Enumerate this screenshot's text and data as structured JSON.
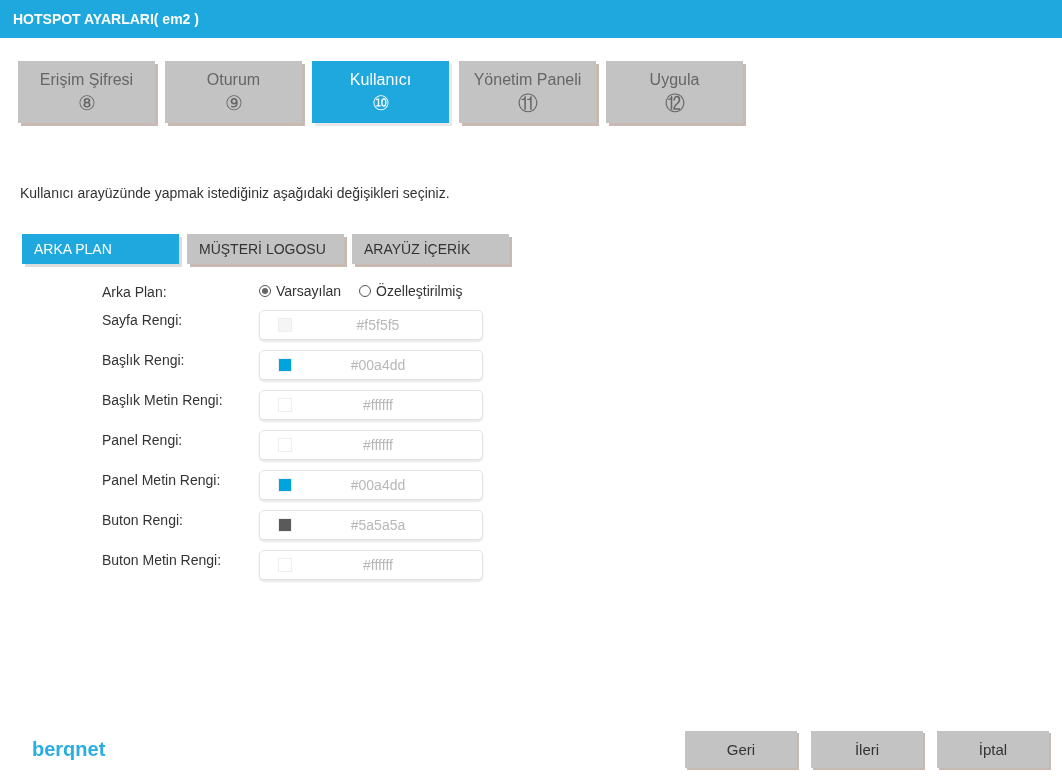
{
  "window": {
    "title": "HOTSPOT AYARLARI( em2 )"
  },
  "steps": [
    {
      "label": "Erişim Şifresi",
      "number": "⑧",
      "selected": false
    },
    {
      "label": "Oturum",
      "number": "⑨",
      "selected": false
    },
    {
      "label": "Kullanıcı",
      "number": "⑩",
      "selected": true
    },
    {
      "label": "Yönetim Paneli",
      "number": "⑪",
      "selected": false
    },
    {
      "label": "Uygula",
      "number": "⑫",
      "selected": false
    }
  ],
  "intro": "Kullanıcı arayüzünde yapmak istediğiniz aşağıdaki değişikleri seçiniz.",
  "tabs": [
    {
      "label": "ARKA PLAN",
      "selected": true
    },
    {
      "label": "MÜŞTERİ LOGOSU",
      "selected": false
    },
    {
      "label": "ARAYÜZ İÇERİK",
      "selected": false
    }
  ],
  "background": {
    "label": "Arka Plan:",
    "options": [
      {
        "label": "Varsayılan",
        "selected": true
      },
      {
        "label": "Özelleştirilmiş",
        "selected": false
      }
    ]
  },
  "fields": [
    {
      "label": "Sayfa Rengi:",
      "value": "#f5f5f5",
      "color": "#f5f5f5"
    },
    {
      "label": "Başlık Rengi:",
      "value": "#00a4dd",
      "color": "#00a4dd"
    },
    {
      "label": "Başlık Metin Rengi:",
      "value": "#ffffff",
      "color": "#ffffff"
    },
    {
      "label": "Panel Rengi:",
      "value": "#ffffff",
      "color": "#ffffff"
    },
    {
      "label": "Panel Metin Rengi:",
      "value": "#00a4dd",
      "color": "#00a4dd"
    },
    {
      "label": "Buton Rengi:",
      "value": "#5a5a5a",
      "color": "#5a5a5a"
    },
    {
      "label": "Buton Metin Rengi:",
      "value": "#ffffff",
      "color": "#ffffff"
    }
  ],
  "footer": {
    "logo": "berqnet",
    "buttons": [
      "Geri",
      "İleri",
      "İptal"
    ]
  }
}
